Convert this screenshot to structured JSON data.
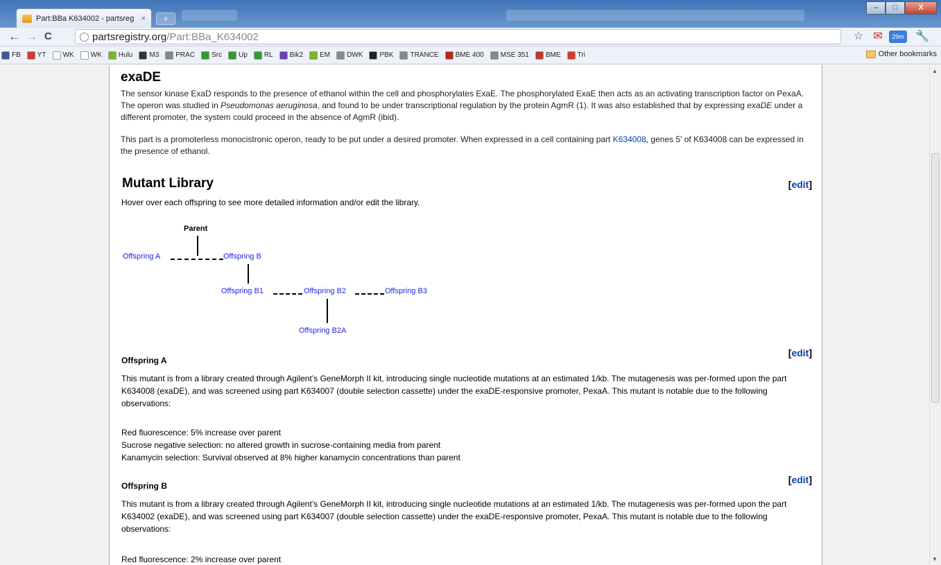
{
  "browser": {
    "tab_title": "Part:BBa K634002 - partsreg",
    "tab_close": "×",
    "new_tab": "+",
    "url_host": "partsregistry.org",
    "url_path": "/Part:BBa_K634002",
    "win_min": "–",
    "win_max": "□",
    "win_close": "X",
    "back": "←",
    "forward": "→",
    "reload": "C",
    "gmail_badge": "29m"
  },
  "bookmarks": [
    {
      "label": "FB",
      "color": "#3b5998"
    },
    {
      "label": "YT",
      "color": "#d43a2c"
    },
    {
      "label": "WK",
      "color": "#ffffff"
    },
    {
      "label": "WK",
      "color": "#ffffff"
    },
    {
      "label": "Hulu",
      "color": "#7bb82a"
    },
    {
      "label": "M3",
      "color": "#333333"
    },
    {
      "label": "PRAC",
      "color": "#888888"
    },
    {
      "label": "Src",
      "color": "#2e9d2e"
    },
    {
      "label": "Up",
      "color": "#2e9d2e"
    },
    {
      "label": "RL",
      "color": "#2e9d2e"
    },
    {
      "label": "Bik2",
      "color": "#6b3fb5"
    },
    {
      "label": "EM",
      "color": "#7bb82a"
    },
    {
      "label": "DWK",
      "color": "#888888"
    },
    {
      "label": "PBK",
      "color": "#222222"
    },
    {
      "label": "TRANCE",
      "color": "#888888"
    },
    {
      "label": "BME 400",
      "color": "#b52a1a"
    },
    {
      "label": "MSE 351",
      "color": "#888888"
    },
    {
      "label": "BME",
      "color": "#c0392b"
    },
    {
      "label": "Tri",
      "color": "#d43a2c"
    }
  ],
  "other_bookmarks": "Other bookmarks",
  "page": {
    "title": "exaDE",
    "para1_a": "The sensor kinase ExaD responds to the presence of ethanol within the cell and phosphorylates ExaE. The phosphorylated ExaE then acts as an activating transcription factor on PexaA. The operon was studied in ",
    "para1_italic1": "Pseudomonas aeruginosa",
    "para1_b": ", and found to be under transcriptional regulation by the protein AgmR (1). It was also established that by expressing ",
    "para1_italic2": "exaDE",
    "para1_c": " under a different promoter, the system could proceed in the absence of AgmR (ibid).",
    "para2_a": "This part is a promoterless monocistronic operon, ready to be put under a desired promoter. When expressed in a cell containing part ",
    "para2_link": "K634008",
    "para2_b": ", genes 5' of K634008 can be expressed in the presence of ethanol.",
    "library_heading": "Mutant Library",
    "edit": "edit",
    "bracket_open": "[",
    "bracket_close": "]",
    "hover_note": "Hover over each offspring to see more detailed information and/or edit the library."
  },
  "tree": {
    "parent": "Parent",
    "offspring_a": "Offspring A",
    "offspring_b": "Offspring B",
    "offspring_b1": "Offspring B1",
    "offspring_b2": "Offspring B2",
    "offspring_b3": "Offspring B3",
    "offspring_b2a": "Offspring B2A"
  },
  "offspring": [
    {
      "title": "Offspring A",
      "text": "This mutant is from a library created through Agilent’s GeneMorph II kit, introducing single nucleotide mutations at an estimated 1/kb. The mutagenesis was per-formed upon the part K634008 (exaDE), and was screened using part K634007 (double selection cassette) under the exaDE-responsive promoter, PexaA. This mutant is notable due to the following observations:",
      "obs": [
        "Red fluorescence: 5% increase over parent",
        "Sucrose negative selection: no altered growth in sucrose-containing media from parent",
        "Kanamycin selection: Survival observed at 8% higher kanamycin concentrations than parent"
      ]
    },
    {
      "title": "Offspring B",
      "text": "This mutant is from a library created through Agilent’s GeneMorph II kit, introducing single nucleotide mutations at an estimated 1/kb. The mutagenesis was per-formed upon the part K634002 (exaDE), and was screened using part K634007 (double selection cassette) under the exaDE-responsive promoter, PexaA. This mutant is notable due to the following observations:",
      "obs": [
        "Red fluorescence: 2% increase over parent"
      ]
    }
  ]
}
